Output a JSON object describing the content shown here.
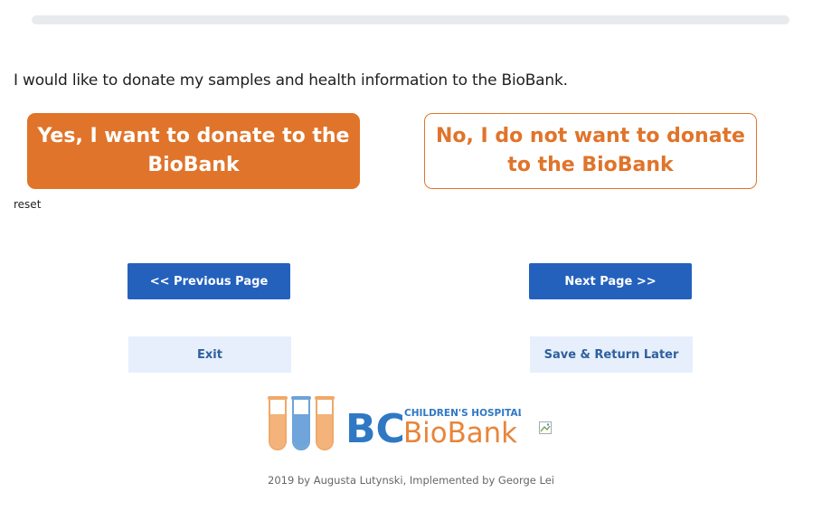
{
  "progress": {
    "fraction": 0
  },
  "question": {
    "text": "I would like to donate my samples and health information to the BioBank."
  },
  "choices": {
    "yes_label": "Yes, I want to donate to the BioBank",
    "no_label": "No, I do not want to donate to the BioBank",
    "reset_label": "reset"
  },
  "nav": {
    "previous_label": "<< Previous Page",
    "next_label": "Next Page >>",
    "exit_label": "Exit",
    "save_label": "Save & Return Later"
  },
  "logo": {
    "letters": "BC",
    "hospital": "CHILDREN'S HOSPITAL",
    "name": "BioBank",
    "icon": "test-tubes-icon"
  },
  "colors": {
    "accent_orange": "#e0742a",
    "primary_blue": "#2461bd",
    "light_blue": "#e6effb",
    "logo_blue": "#2f78c4"
  },
  "footer": {
    "text": "2019 by Augusta Lutynski, Implemented by George Lei"
  }
}
